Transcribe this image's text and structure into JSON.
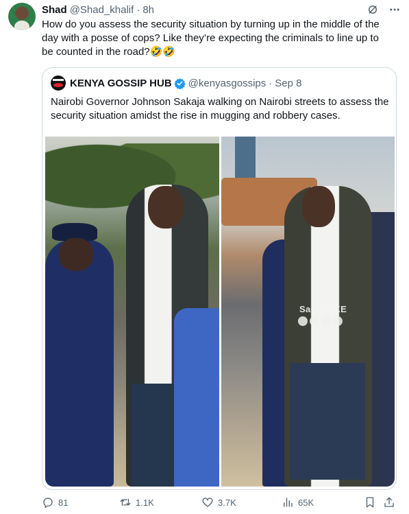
{
  "tweet": {
    "author_name": "Shad",
    "author_handle": "@Shad_khalif",
    "separator": "·",
    "time": "8h",
    "text": "How do you assess the security situation by turning up in the middle of the\nday with a posse of cops? Like they’re expecting the criminals to line up to\nbe counted in the road?🤣🤣"
  },
  "quote": {
    "author_name": "KENYA GOSSIP HUB",
    "author_handle": "@kenyasgossips",
    "separator": "·",
    "date": "Sep 8",
    "text": "Nairobi Governor Johnson Sakaja walking on Nairobi streets to assess the security situation amidst the rise in mugging and robbery cases.",
    "media_watermark": "SautiTVKE"
  },
  "actions": {
    "replies": "81",
    "retweets": "1.1K",
    "likes": "3.7K",
    "views": "65K"
  },
  "icons": {
    "header": [
      "grok-icon",
      "more-icon"
    ],
    "verified": "verified-badge-icon",
    "actions": [
      "reply-icon",
      "retweet-icon",
      "like-icon",
      "views-icon",
      "bookmark-icon",
      "share-icon"
    ]
  },
  "colors": {
    "text": "#0f1419",
    "secondary": "#536471",
    "border": "#cfd9de",
    "verified": "#1d9bf0"
  }
}
